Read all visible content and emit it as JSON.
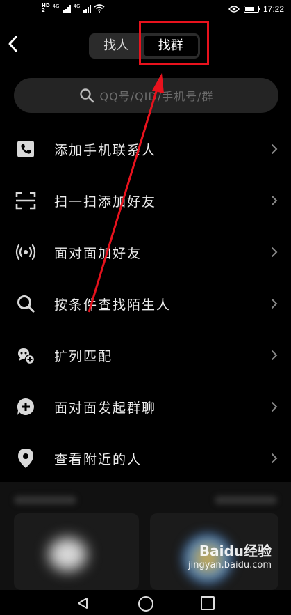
{
  "status_bar": {
    "sim1_label": "HD",
    "sim2_label": "HD",
    "network1": "4G",
    "network2": "4G",
    "battery_level_percent": 70,
    "time": "17:22"
  },
  "header": {
    "tabs": [
      {
        "label": "找人",
        "active": false
      },
      {
        "label": "找群",
        "active": true
      }
    ],
    "highlight_color": "#e8121d"
  },
  "search": {
    "placeholder": "QQ号/QID/手机号/群"
  },
  "menu": {
    "items": [
      {
        "icon": "phone-icon",
        "label": "添加手机联系人"
      },
      {
        "icon": "scan-icon",
        "label": "扫一扫添加好友"
      },
      {
        "icon": "radar-icon",
        "label": "面对面加好友"
      },
      {
        "icon": "search-icon",
        "label": "按条件查找陌生人"
      },
      {
        "icon": "match-icon",
        "label": "扩列匹配"
      },
      {
        "icon": "group-chat-icon",
        "label": "面对面发起群聊"
      },
      {
        "icon": "location-icon",
        "label": "查看附近的人"
      }
    ]
  },
  "watermark": {
    "brand": "Baidu经验",
    "url": "jingyan.baidu.com"
  }
}
